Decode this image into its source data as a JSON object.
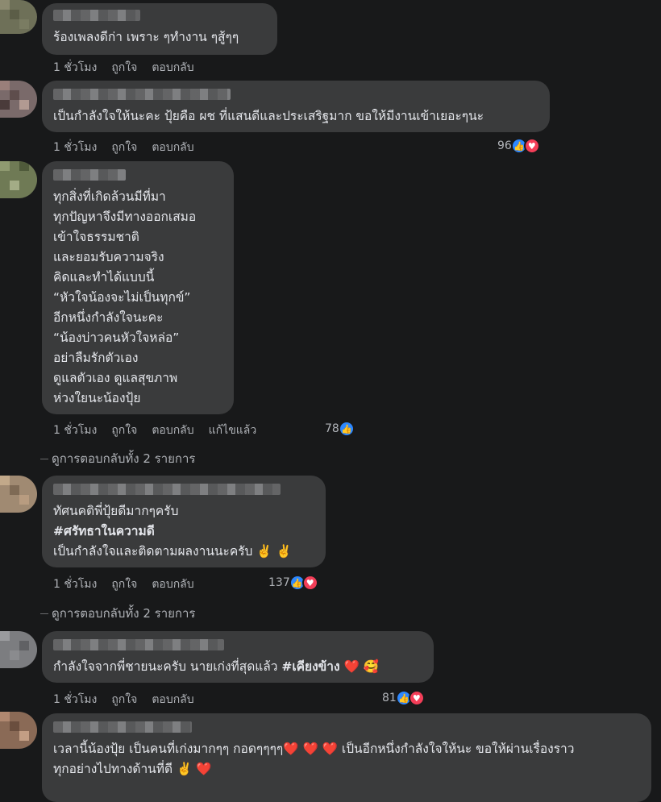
{
  "comments": [
    {
      "text": "ร้องเพลงดีก่า เพราะ ๆทำงาน ๆสู้ๆๆ",
      "time": "1 ชั่วโมง",
      "like_label": "ถูกใจ",
      "reply_label": "ตอบกลับ"
    },
    {
      "text": "เป็นกำลังใจให้นะคะ ปุ้ยคือ ผช ที่แสนดีและประเสริฐมาก ขอให้มีงานเข้าเยอะๆนะ",
      "time": "1 ชั่วโมง",
      "like_label": "ถูกใจ",
      "reply_label": "ตอบกลับ",
      "reaction_count": "96"
    },
    {
      "text": "ทุกสิ่งที่เกิดล้วนมีที่มา\nทุกปัญหาจึงมีทางออกเสมอ\nเข้าใจธรรมชาติ\nและยอมรับความจริง\nคิดและทำได้แบบนี้\n“หัวใจน้องจะไม่เป็นทุกข์”\nอีกหนึ่งกำลังใจนะคะ\n“น้องบ่าวคนหัวใจหล่อ”\nอย่าลืมรักตัวเอง\nดูแลตัวเอง ดูแลสุขภาพ\nห่วงใยนะน้องปุ้ย",
      "time": "1 ชั่วโมง",
      "like_label": "ถูกใจ",
      "reply_label": "ตอบกลับ",
      "edited_label": "แก้ไขแล้ว",
      "reaction_count": "78",
      "view_replies": "ดูการตอบกลับทั้ง 2 รายการ"
    },
    {
      "line1": "ทัศนคติพี่ปุ้ยดีมากๆครับ",
      "line2": "#ศรัทธาในความดี",
      "line3": "เป็นกำลังใจและติดตามผลงานนะครับ ✌️ ✌️",
      "time": "1 ชั่วโมง",
      "like_label": "ถูกใจ",
      "reply_label": "ตอบกลับ",
      "reaction_count": "137",
      "view_replies": "ดูการตอบกลับทั้ง 2 รายการ"
    },
    {
      "text_a": "กำลังใจจากพี่ชายนะครับ นายเก่งที่สุดแล้ว ",
      "text_b": "#เคียงข้าง",
      "text_c": " ❤️ 🥰",
      "time": "1 ชั่วโมง",
      "like_label": "ถูกใจ",
      "reply_label": "ตอบกลับ",
      "reaction_count": "81"
    },
    {
      "text": "เวลานี้น้องปุ้ย เป็นคนที่เก่งมากๆๆ กอดๆๆๆๆ❤️ ❤️ ❤️  เป็นอีกหนึ่งกำลังใจให้นะ ขอให้ผ่านเรื่องราว\nทุกอย่างไปทางด้านที่ดี ✌️ ❤️"
    }
  ],
  "colors": {
    "background": "#18191a",
    "bubble": "#3a3b3c",
    "like": "#2d88ff",
    "love": "#f33e58"
  },
  "icons": {
    "like": "like-reaction-icon",
    "love": "love-reaction-icon"
  }
}
